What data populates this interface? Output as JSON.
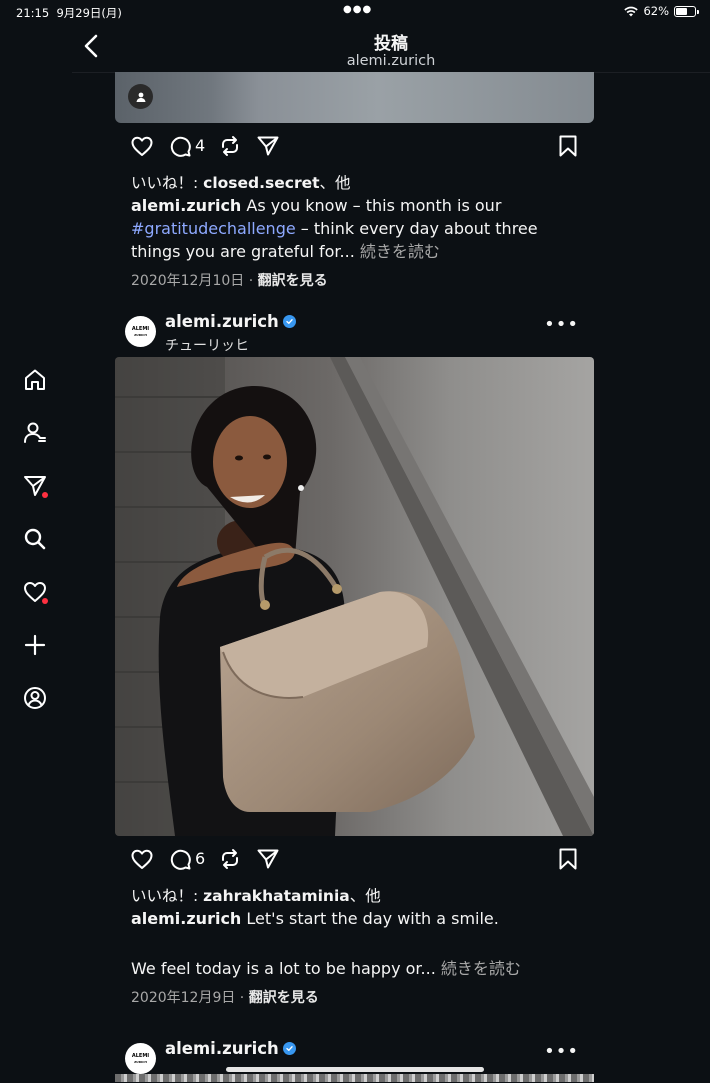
{
  "status": {
    "time": "21:15",
    "date": "9月29日(月)",
    "battery": "62%",
    "battery_level": 0.62
  },
  "header": {
    "title": "投稿",
    "subtitle": "alemi.zurich"
  },
  "nav": [
    "home-icon",
    "people-icon",
    "send-icon",
    "search-icon",
    "heart-icon",
    "plus-icon",
    "profile-icon"
  ],
  "post1": {
    "comments": "4",
    "likes_prefix": "いいね！: ",
    "likes_user": "closed.secret",
    "likes_suffix": "、他",
    "caption_user": "alemi.zurich",
    "caption_text1": " As you know – this month is our ",
    "hashtag": "#gratitudechallenge",
    "caption_text2": " – think every day about three things you are grateful for...",
    "more": " 続きを読む",
    "date": "2020年12月10日",
    "dot": " · ",
    "translate": "翻訳を見る"
  },
  "post2": {
    "user": "alemi.zurich",
    "location": "チューリッヒ",
    "avatar_text_1": "ALEMI",
    "avatar_text_2": "ZURICH",
    "comments": "6",
    "likes_prefix": "いいね！: ",
    "likes_user": "zahrakhataminia",
    "likes_suffix": "、他",
    "caption_user": "alemi.zurich",
    "caption_text1": " Let's start the day with a smile.",
    "caption_text2": "We feel today is a lot to be happy or...",
    "more": " 続きを読む",
    "date": "2020年12月9日",
    "dot": " · ",
    "translate": "翻訳を見る"
  },
  "post3": {
    "user": "alemi.zurich",
    "avatar_text_1": "ALEMI",
    "avatar_text_2": "ZURICH"
  },
  "colors": {
    "background": "#0c1014",
    "hashtag": "#8ea9ff",
    "verified": "#3897f0",
    "notification": "#ff3040"
  }
}
